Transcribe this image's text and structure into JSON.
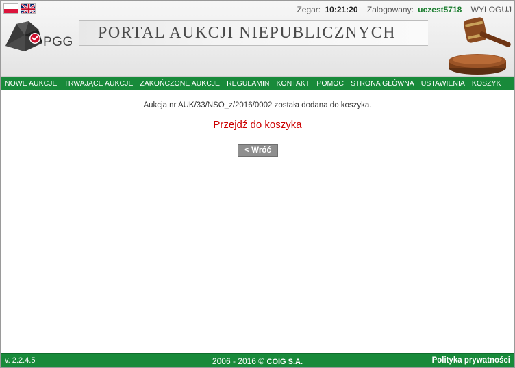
{
  "header": {
    "flags": [
      "flag-pl-icon",
      "flag-gb-icon"
    ],
    "clock_label": "Zegar:",
    "clock_value": "10:21:20",
    "user_label": "Zalogowany:",
    "user_name": "uczest5718",
    "logout_label": "WYLOGUJ",
    "logo_text": "PGG",
    "portal_title": "PORTAL AUKCJI NIEPUBLICZNYCH"
  },
  "nav": {
    "items": [
      "NOWE AUKCJE",
      "TRWAJĄCE AUKCJE",
      "ZAKOŃCZONE AUKCJE",
      "REGULAMIN",
      "KONTAKT",
      "POMOC",
      "STRONA GŁÓWNA",
      "USTAWIENIA",
      "KOSZYK"
    ]
  },
  "main": {
    "message": "Aukcja nr AUK/33/NSO_z/2016/0002 została dodana do koszyka.",
    "cart_link": "Przejdź do koszyka",
    "back_button": "< Wróć"
  },
  "footer": {
    "version": "v. 2.2.4.5",
    "copyright_prefix": "2006 - 2016 © ",
    "copyright_brand": "COIG S.A.",
    "privacy": "Polityka prywatności"
  },
  "colors": {
    "nav_green": "#188a3a",
    "user_green": "#1a7d2e",
    "link_red": "#cc0000",
    "button_gray": "#8f8f8f"
  }
}
